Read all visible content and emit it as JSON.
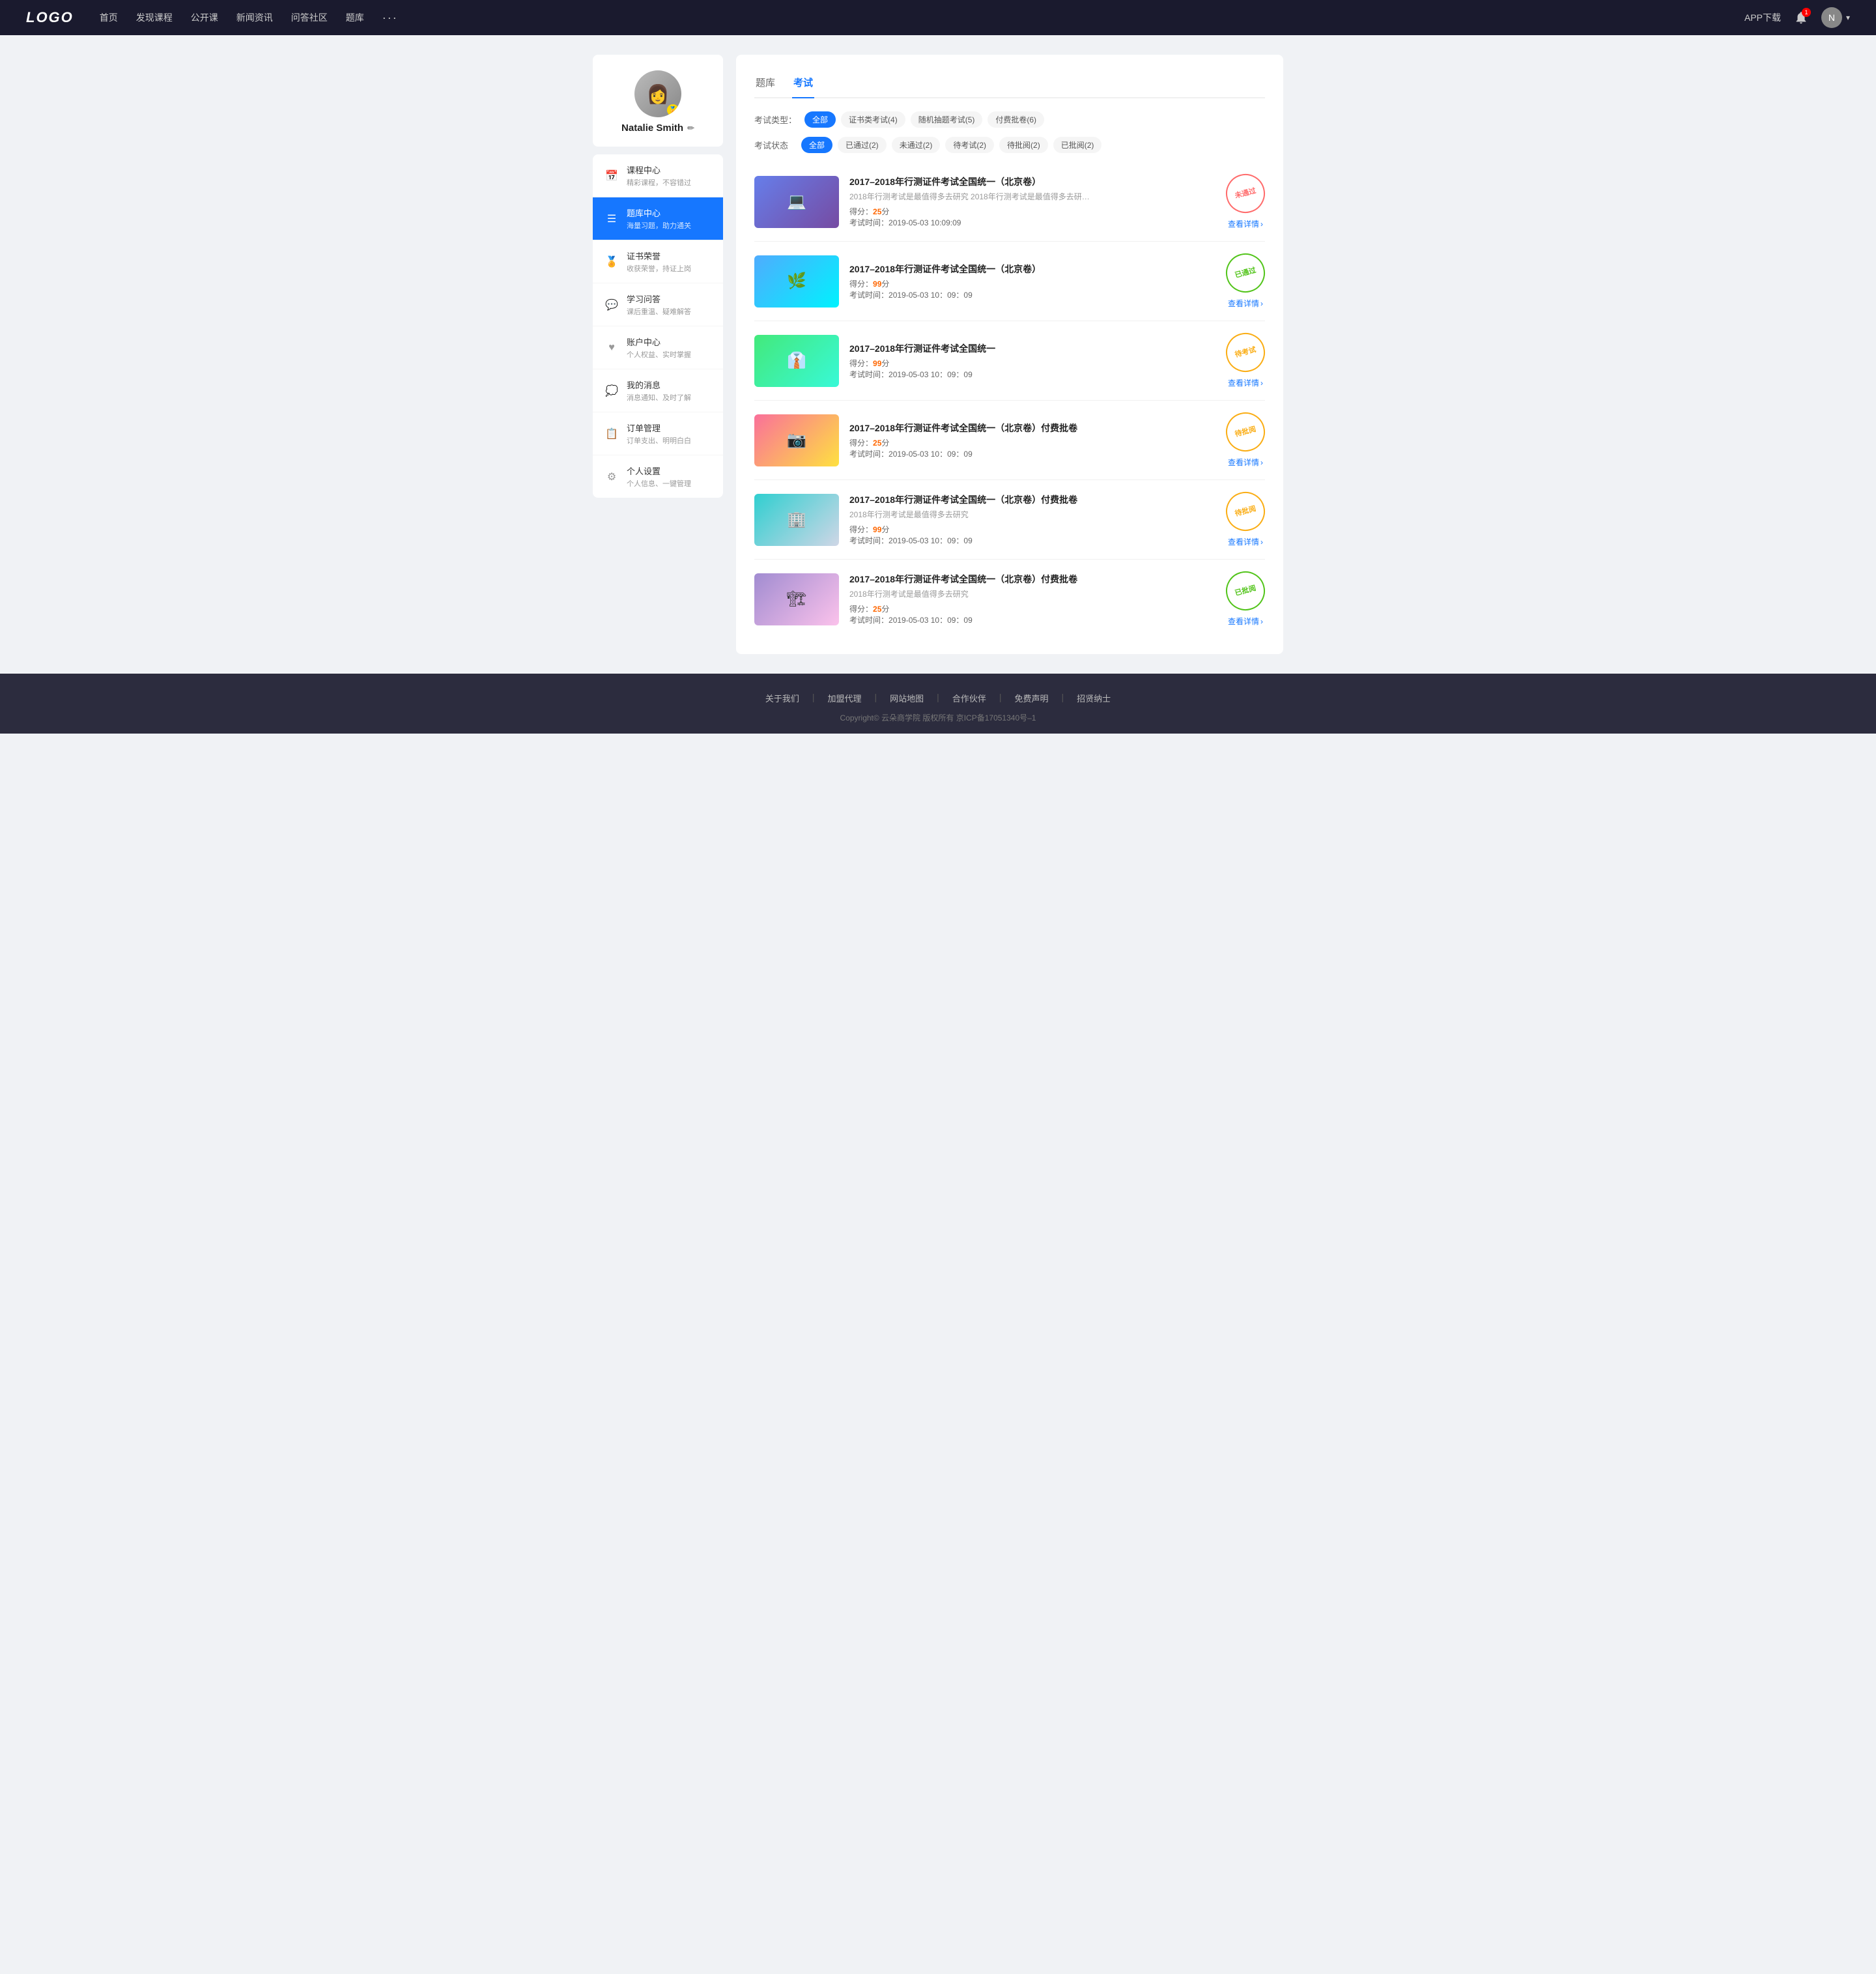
{
  "navbar": {
    "logo": "LOGO",
    "links": [
      "首页",
      "发现课程",
      "公开课",
      "新闻资讯",
      "问答社区",
      "题库"
    ],
    "more": "···",
    "app_download": "APP下载",
    "user_name": "Natalie Smith"
  },
  "sidebar": {
    "user_name": "Natalie Smith",
    "edit_label": "编辑",
    "menu_items": [
      {
        "id": "course-center",
        "icon": "📅",
        "title": "课程中心",
        "subtitle": "精彩课程，不容错过",
        "active": false
      },
      {
        "id": "question-bank",
        "icon": "☰",
        "title": "题库中心",
        "subtitle": "海量习题，助力通关",
        "active": true
      },
      {
        "id": "certificates",
        "icon": "🏅",
        "title": "证书荣誉",
        "subtitle": "收获荣誉，持证上岗",
        "active": false
      },
      {
        "id": "qa",
        "icon": "💬",
        "title": "学习问答",
        "subtitle": "课后重温、疑难解答",
        "active": false
      },
      {
        "id": "account",
        "icon": "♥",
        "title": "账户中心",
        "subtitle": "个人权益、实时掌握",
        "active": false
      },
      {
        "id": "messages",
        "icon": "💭",
        "title": "我的消息",
        "subtitle": "消息通知、及时了解",
        "active": false
      },
      {
        "id": "orders",
        "icon": "📋",
        "title": "订单管理",
        "subtitle": "订单支出、明明白白",
        "active": false
      },
      {
        "id": "settings",
        "icon": "⚙",
        "title": "个人设置",
        "subtitle": "个人信息、一键管理",
        "active": false
      }
    ]
  },
  "content": {
    "tabs": [
      {
        "id": "question-bank-tab",
        "label": "题库",
        "active": false
      },
      {
        "id": "exam-tab",
        "label": "考试",
        "active": true
      }
    ],
    "filter_type": {
      "label": "考试类型：",
      "options": [
        {
          "label": "全部",
          "active": true
        },
        {
          "label": "证书类考试(4)",
          "active": false
        },
        {
          "label": "随机抽题考试(5)",
          "active": false
        },
        {
          "label": "付费批卷(6)",
          "active": false
        }
      ]
    },
    "filter_status": {
      "label": "考试状态",
      "options": [
        {
          "label": "全部",
          "active": true
        },
        {
          "label": "已通过(2)",
          "active": false
        },
        {
          "label": "未通过(2)",
          "active": false
        },
        {
          "label": "待考试(2)",
          "active": false
        },
        {
          "label": "待批阅(2)",
          "active": false
        },
        {
          "label": "已批阅(2)",
          "active": false
        }
      ]
    },
    "exam_items": [
      {
        "id": "exam-1",
        "thumb_class": "thumb-1",
        "thumb_emoji": "💻",
        "title": "2017–2018年行测证件考试全国统一（北京卷）",
        "desc": "2018年行测考试是最值得多去研究 2018年行测考试是最值得多去研究 2018年行...",
        "score_label": "得分：",
        "score": "25",
        "score_unit": "分",
        "time_label": "考试时间：",
        "time": "2019-05-03  10:09:09",
        "stamp_text": "未通过",
        "stamp_class": "stamp-unpass",
        "view_label": "查看详情"
      },
      {
        "id": "exam-2",
        "thumb_class": "thumb-2",
        "thumb_emoji": "🌿",
        "title": "2017–2018年行测证件考试全国统一（北京卷）",
        "desc": "",
        "score_label": "得分：",
        "score": "99",
        "score_unit": "分",
        "time_label": "考试时间：",
        "time": "2019-05-03  10：09：09",
        "stamp_text": "已通过",
        "stamp_class": "stamp-pass",
        "view_label": "查看详情"
      },
      {
        "id": "exam-3",
        "thumb_class": "thumb-3",
        "thumb_emoji": "👔",
        "title": "2017–2018年行测证件考试全国统一",
        "desc": "",
        "score_label": "得分：",
        "score": "99",
        "score_unit": "分",
        "time_label": "考试时间：",
        "time": "2019-05-03  10：09：09",
        "stamp_text": "待考试",
        "stamp_class": "stamp-pending",
        "view_label": "查看详情"
      },
      {
        "id": "exam-4",
        "thumb_class": "thumb-4",
        "thumb_emoji": "📷",
        "title": "2017–2018年行测证件考试全国统一（北京卷）付费批卷",
        "desc": "",
        "score_label": "得分：",
        "score": "25",
        "score_unit": "分",
        "time_label": "考试时间：",
        "time": "2019-05-03  10：09：09",
        "stamp_text": "待批阅",
        "stamp_class": "stamp-reviewing",
        "view_label": "查看详情"
      },
      {
        "id": "exam-5",
        "thumb_class": "thumb-5",
        "thumb_emoji": "🏢",
        "title": "2017–2018年行测证件考试全国统一（北京卷）付费批卷",
        "desc": "2018年行测考试是最值得多去研究",
        "score_label": "得分：",
        "score": "99",
        "score_unit": "分",
        "time_label": "考试时间：",
        "time": "2019-05-03  10：09：09",
        "stamp_text": "待批阅",
        "stamp_class": "stamp-reviewing",
        "view_label": "查看详情"
      },
      {
        "id": "exam-6",
        "thumb_class": "thumb-6",
        "thumb_emoji": "🏗",
        "title": "2017–2018年行测证件考试全国统一（北京卷）付费批卷",
        "desc": "2018年行测考试是最值得多去研究",
        "score_label": "得分：",
        "score": "25",
        "score_unit": "分",
        "time_label": "考试时间：",
        "time": "2019-05-03  10：09：09",
        "stamp_text": "已批阅",
        "stamp_class": "stamp-reviewed",
        "view_label": "查看详情"
      }
    ]
  },
  "footer": {
    "links": [
      "关于我们",
      "加盟代理",
      "网站地图",
      "合作伙伴",
      "免费声明",
      "招贤纳士"
    ],
    "copyright": "Copyright© 云朵商学院  版权所有    京ICP备17051340号–1"
  }
}
